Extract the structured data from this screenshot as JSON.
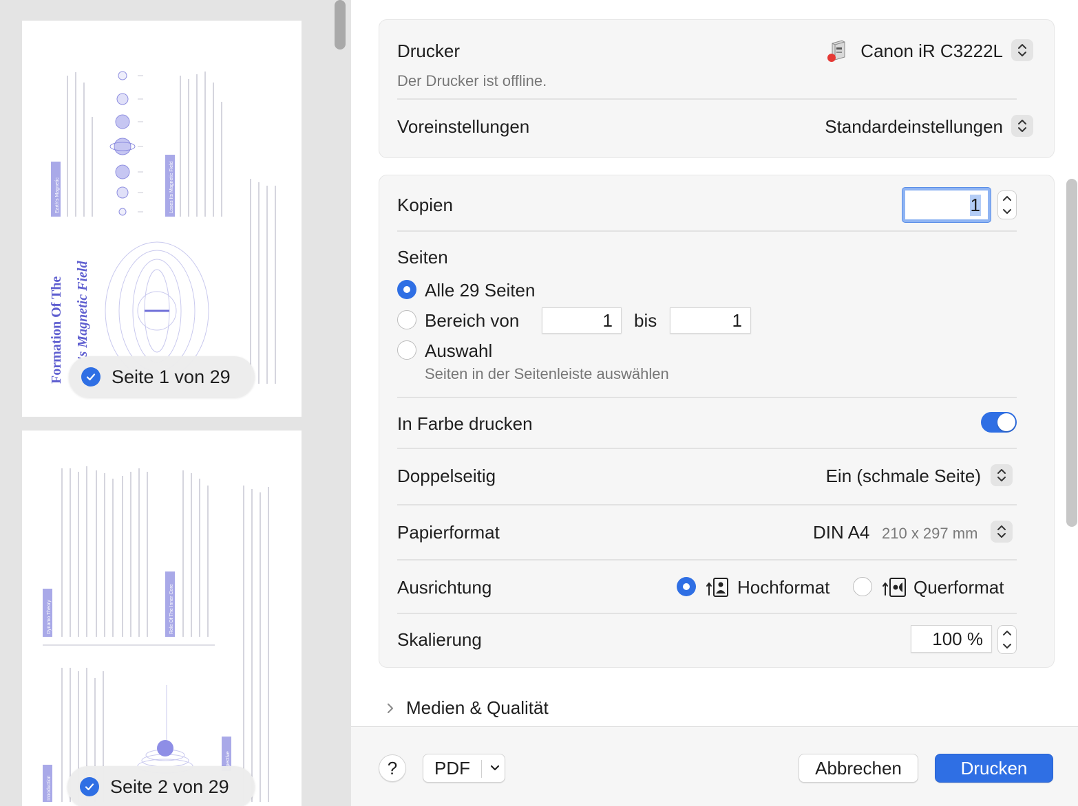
{
  "sidebar": {
    "pages": [
      {
        "label": "Seite 1 von 29",
        "selected": true
      },
      {
        "label": "Seite 2 von 29",
        "selected": true
      }
    ],
    "thumb1": {
      "title_line1": "Formation Of The",
      "title_line2": "'s Magnetic Field",
      "tag_left": "Earth's Magnetic",
      "tag_mid": "Loses Its Magnetic Field"
    },
    "thumb2": {
      "tag_1": "Dynamo Theory",
      "tag_2": "Role Of The Inner Core",
      "tag_3": "Introduction",
      "tag_4": "spective"
    }
  },
  "printer": {
    "label": "Drucker",
    "name": "Canon iR C3222L",
    "status": "Der Drucker ist offline.",
    "icon": "printer-icon"
  },
  "presets": {
    "label": "Voreinstellungen",
    "value": "Standardeinstellungen"
  },
  "copies": {
    "label": "Kopien",
    "value": "1"
  },
  "pages": {
    "label": "Seiten",
    "options": {
      "all": "Alle 29 Seiten",
      "range": "Bereich von",
      "range_to": "bis",
      "selection": "Auswahl",
      "selection_hint": "Seiten in der Seitenleiste auswählen"
    },
    "range_from": "1",
    "range_until": "1",
    "selected": "all"
  },
  "color": {
    "label": "In Farbe drucken",
    "enabled": true
  },
  "duplex": {
    "label": "Doppelseitig",
    "value": "Ein (schmale Seite)"
  },
  "paper": {
    "label": "Papierformat",
    "value": "DIN A4",
    "dimensions": "210 x 297 mm"
  },
  "orientation": {
    "label": "Ausrichtung",
    "portrait": "Hochformat",
    "landscape": "Querformat",
    "selected": "portrait"
  },
  "scaling": {
    "label": "Skalierung",
    "value": "100 %"
  },
  "media_quality": {
    "label": "Medien & Qualität"
  },
  "footer": {
    "help": "?",
    "pdf": "PDF",
    "cancel": "Abbrechen",
    "print": "Drucken"
  },
  "colors": {
    "accent": "#2f6fe4",
    "thumb_purple": "#6f6fd8"
  }
}
